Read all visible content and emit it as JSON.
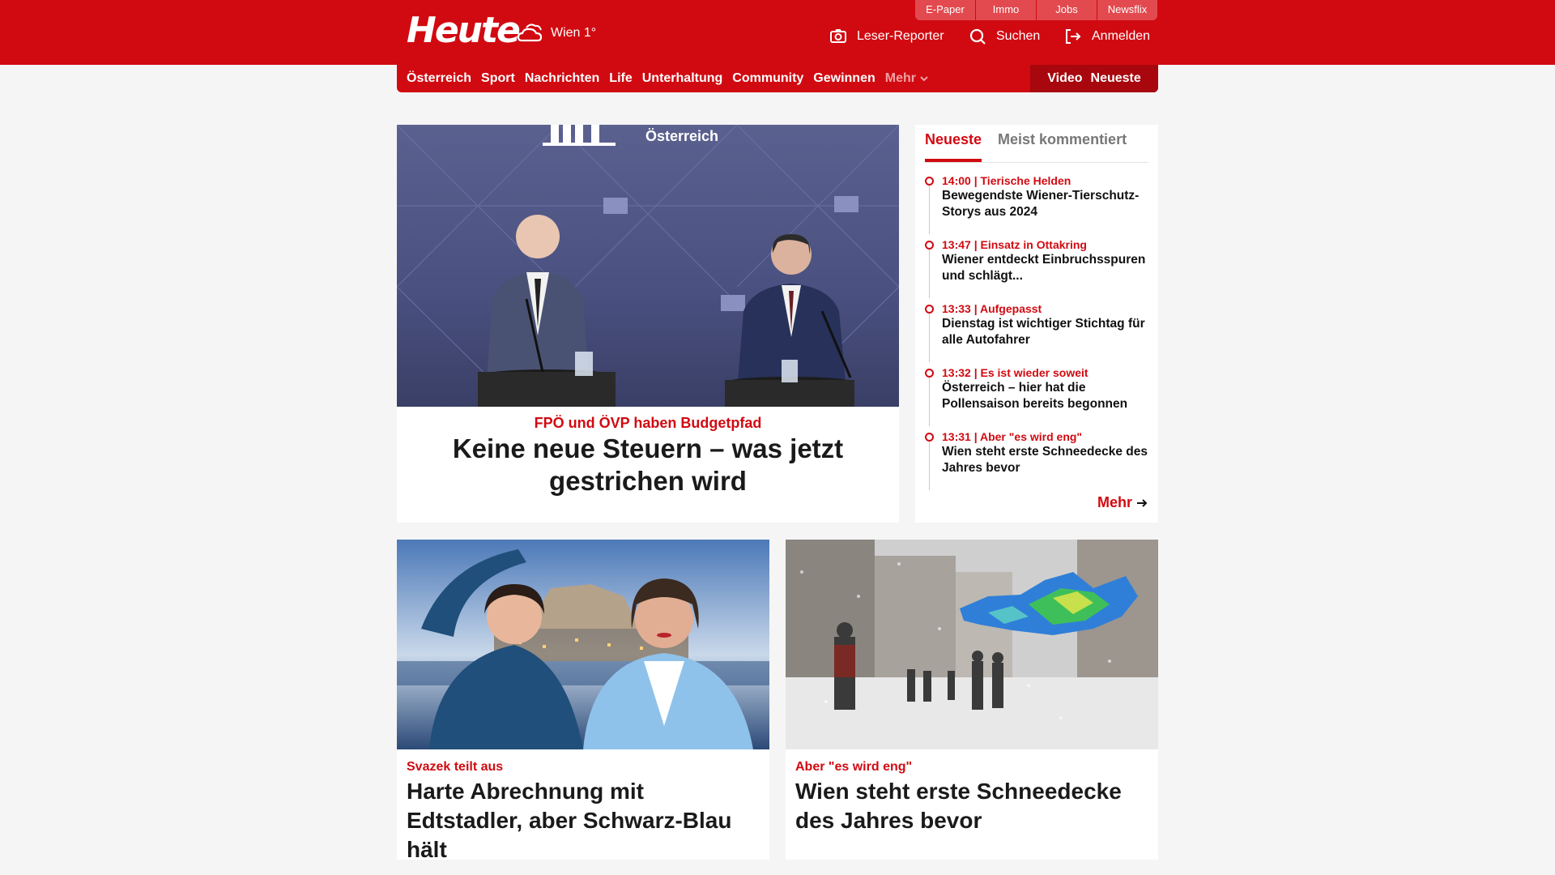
{
  "header": {
    "logo": "Heute",
    "weather": "Wien 1°",
    "top_links": [
      "E-Paper",
      "Immo",
      "Jobs",
      "Newsflix"
    ],
    "actions": {
      "reporter": "Leser-Reporter",
      "search": "Suchen",
      "login": "Anmelden"
    }
  },
  "nav": {
    "items": [
      "Österreich",
      "Sport",
      "Nachrichten",
      "Life",
      "Unterhaltung",
      "Community",
      "Gewinnen"
    ],
    "more": "Mehr",
    "video": "Video",
    "neueste": "Neueste"
  },
  "hero": {
    "image_overlay": "Österreich",
    "kicker": "FPÖ und ÖVP haben Budgetpfad",
    "title": "Keine neue Steuern – was jetzt gestrichen wird"
  },
  "sidebar": {
    "tabs": [
      "Neueste",
      "Meist kommentiert"
    ],
    "items": [
      {
        "meta": "14:00 | Tierische Helden",
        "title": "Bewegendste Wiener-Tierschutz-Storys aus 2024"
      },
      {
        "meta": "13:47 | Einsatz in Ottakring",
        "title": "Wiener entdeckt Einbruchsspuren und schlägt..."
      },
      {
        "meta": "13:33 | Aufgepasst",
        "title": "Dienstag ist wichtiger Stichtag für alle Autofahrer"
      },
      {
        "meta": "13:32 | Es ist wieder soweit",
        "title": "Österreich – hier hat die Pollensaison bereits begonnen"
      },
      {
        "meta": "13:31 | Aber \"es wird eng\"",
        "title": "Wien steht erste Schneedecke des Jahres bevor"
      }
    ],
    "more": "Mehr"
  },
  "cards": [
    {
      "kicker": "Svazek teilt aus",
      "title": "Harte Abrechnung mit Edtstadler, aber Schwarz-Blau hält"
    },
    {
      "kicker": "Aber \"es wird eng\"",
      "title": "Wien steht erste Schneedecke des Jahres bevor"
    }
  ],
  "colors": {
    "brand": "#d10a11",
    "brand_dark": "#a7070d"
  }
}
